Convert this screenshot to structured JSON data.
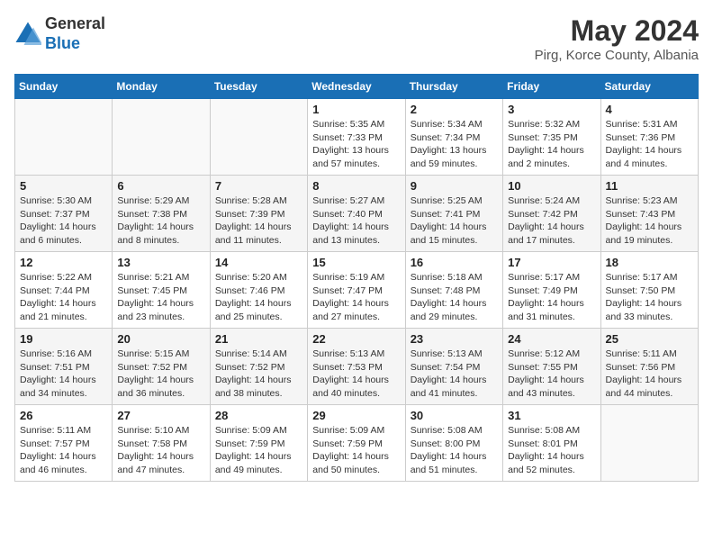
{
  "logo": {
    "general": "General",
    "blue": "Blue"
  },
  "title": "May 2024",
  "location": "Pirg, Korce County, Albania",
  "days_header": [
    "Sunday",
    "Monday",
    "Tuesday",
    "Wednesday",
    "Thursday",
    "Friday",
    "Saturday"
  ],
  "weeks": [
    [
      {
        "day": "",
        "sunrise": "",
        "sunset": "",
        "daylight": ""
      },
      {
        "day": "",
        "sunrise": "",
        "sunset": "",
        "daylight": ""
      },
      {
        "day": "",
        "sunrise": "",
        "sunset": "",
        "daylight": ""
      },
      {
        "day": "1",
        "sunrise": "Sunrise: 5:35 AM",
        "sunset": "Sunset: 7:33 PM",
        "daylight": "Daylight: 13 hours and 57 minutes."
      },
      {
        "day": "2",
        "sunrise": "Sunrise: 5:34 AM",
        "sunset": "Sunset: 7:34 PM",
        "daylight": "Daylight: 13 hours and 59 minutes."
      },
      {
        "day": "3",
        "sunrise": "Sunrise: 5:32 AM",
        "sunset": "Sunset: 7:35 PM",
        "daylight": "Daylight: 14 hours and 2 minutes."
      },
      {
        "day": "4",
        "sunrise": "Sunrise: 5:31 AM",
        "sunset": "Sunset: 7:36 PM",
        "daylight": "Daylight: 14 hours and 4 minutes."
      }
    ],
    [
      {
        "day": "5",
        "sunrise": "Sunrise: 5:30 AM",
        "sunset": "Sunset: 7:37 PM",
        "daylight": "Daylight: 14 hours and 6 minutes."
      },
      {
        "day": "6",
        "sunrise": "Sunrise: 5:29 AM",
        "sunset": "Sunset: 7:38 PM",
        "daylight": "Daylight: 14 hours and 8 minutes."
      },
      {
        "day": "7",
        "sunrise": "Sunrise: 5:28 AM",
        "sunset": "Sunset: 7:39 PM",
        "daylight": "Daylight: 14 hours and 11 minutes."
      },
      {
        "day": "8",
        "sunrise": "Sunrise: 5:27 AM",
        "sunset": "Sunset: 7:40 PM",
        "daylight": "Daylight: 14 hours and 13 minutes."
      },
      {
        "day": "9",
        "sunrise": "Sunrise: 5:25 AM",
        "sunset": "Sunset: 7:41 PM",
        "daylight": "Daylight: 14 hours and 15 minutes."
      },
      {
        "day": "10",
        "sunrise": "Sunrise: 5:24 AM",
        "sunset": "Sunset: 7:42 PM",
        "daylight": "Daylight: 14 hours and 17 minutes."
      },
      {
        "day": "11",
        "sunrise": "Sunrise: 5:23 AM",
        "sunset": "Sunset: 7:43 PM",
        "daylight": "Daylight: 14 hours and 19 minutes."
      }
    ],
    [
      {
        "day": "12",
        "sunrise": "Sunrise: 5:22 AM",
        "sunset": "Sunset: 7:44 PM",
        "daylight": "Daylight: 14 hours and 21 minutes."
      },
      {
        "day": "13",
        "sunrise": "Sunrise: 5:21 AM",
        "sunset": "Sunset: 7:45 PM",
        "daylight": "Daylight: 14 hours and 23 minutes."
      },
      {
        "day": "14",
        "sunrise": "Sunrise: 5:20 AM",
        "sunset": "Sunset: 7:46 PM",
        "daylight": "Daylight: 14 hours and 25 minutes."
      },
      {
        "day": "15",
        "sunrise": "Sunrise: 5:19 AM",
        "sunset": "Sunset: 7:47 PM",
        "daylight": "Daylight: 14 hours and 27 minutes."
      },
      {
        "day": "16",
        "sunrise": "Sunrise: 5:18 AM",
        "sunset": "Sunset: 7:48 PM",
        "daylight": "Daylight: 14 hours and 29 minutes."
      },
      {
        "day": "17",
        "sunrise": "Sunrise: 5:17 AM",
        "sunset": "Sunset: 7:49 PM",
        "daylight": "Daylight: 14 hours and 31 minutes."
      },
      {
        "day": "18",
        "sunrise": "Sunrise: 5:17 AM",
        "sunset": "Sunset: 7:50 PM",
        "daylight": "Daylight: 14 hours and 33 minutes."
      }
    ],
    [
      {
        "day": "19",
        "sunrise": "Sunrise: 5:16 AM",
        "sunset": "Sunset: 7:51 PM",
        "daylight": "Daylight: 14 hours and 34 minutes."
      },
      {
        "day": "20",
        "sunrise": "Sunrise: 5:15 AM",
        "sunset": "Sunset: 7:52 PM",
        "daylight": "Daylight: 14 hours and 36 minutes."
      },
      {
        "day": "21",
        "sunrise": "Sunrise: 5:14 AM",
        "sunset": "Sunset: 7:52 PM",
        "daylight": "Daylight: 14 hours and 38 minutes."
      },
      {
        "day": "22",
        "sunrise": "Sunrise: 5:13 AM",
        "sunset": "Sunset: 7:53 PM",
        "daylight": "Daylight: 14 hours and 40 minutes."
      },
      {
        "day": "23",
        "sunrise": "Sunrise: 5:13 AM",
        "sunset": "Sunset: 7:54 PM",
        "daylight": "Daylight: 14 hours and 41 minutes."
      },
      {
        "day": "24",
        "sunrise": "Sunrise: 5:12 AM",
        "sunset": "Sunset: 7:55 PM",
        "daylight": "Daylight: 14 hours and 43 minutes."
      },
      {
        "day": "25",
        "sunrise": "Sunrise: 5:11 AM",
        "sunset": "Sunset: 7:56 PM",
        "daylight": "Daylight: 14 hours and 44 minutes."
      }
    ],
    [
      {
        "day": "26",
        "sunrise": "Sunrise: 5:11 AM",
        "sunset": "Sunset: 7:57 PM",
        "daylight": "Daylight: 14 hours and 46 minutes."
      },
      {
        "day": "27",
        "sunrise": "Sunrise: 5:10 AM",
        "sunset": "Sunset: 7:58 PM",
        "daylight": "Daylight: 14 hours and 47 minutes."
      },
      {
        "day": "28",
        "sunrise": "Sunrise: 5:09 AM",
        "sunset": "Sunset: 7:59 PM",
        "daylight": "Daylight: 14 hours and 49 minutes."
      },
      {
        "day": "29",
        "sunrise": "Sunrise: 5:09 AM",
        "sunset": "Sunset: 7:59 PM",
        "daylight": "Daylight: 14 hours and 50 minutes."
      },
      {
        "day": "30",
        "sunrise": "Sunrise: 5:08 AM",
        "sunset": "Sunset: 8:00 PM",
        "daylight": "Daylight: 14 hours and 51 minutes."
      },
      {
        "day": "31",
        "sunrise": "Sunrise: 5:08 AM",
        "sunset": "Sunset: 8:01 PM",
        "daylight": "Daylight: 14 hours and 52 minutes."
      },
      {
        "day": "",
        "sunrise": "",
        "sunset": "",
        "daylight": ""
      }
    ]
  ]
}
